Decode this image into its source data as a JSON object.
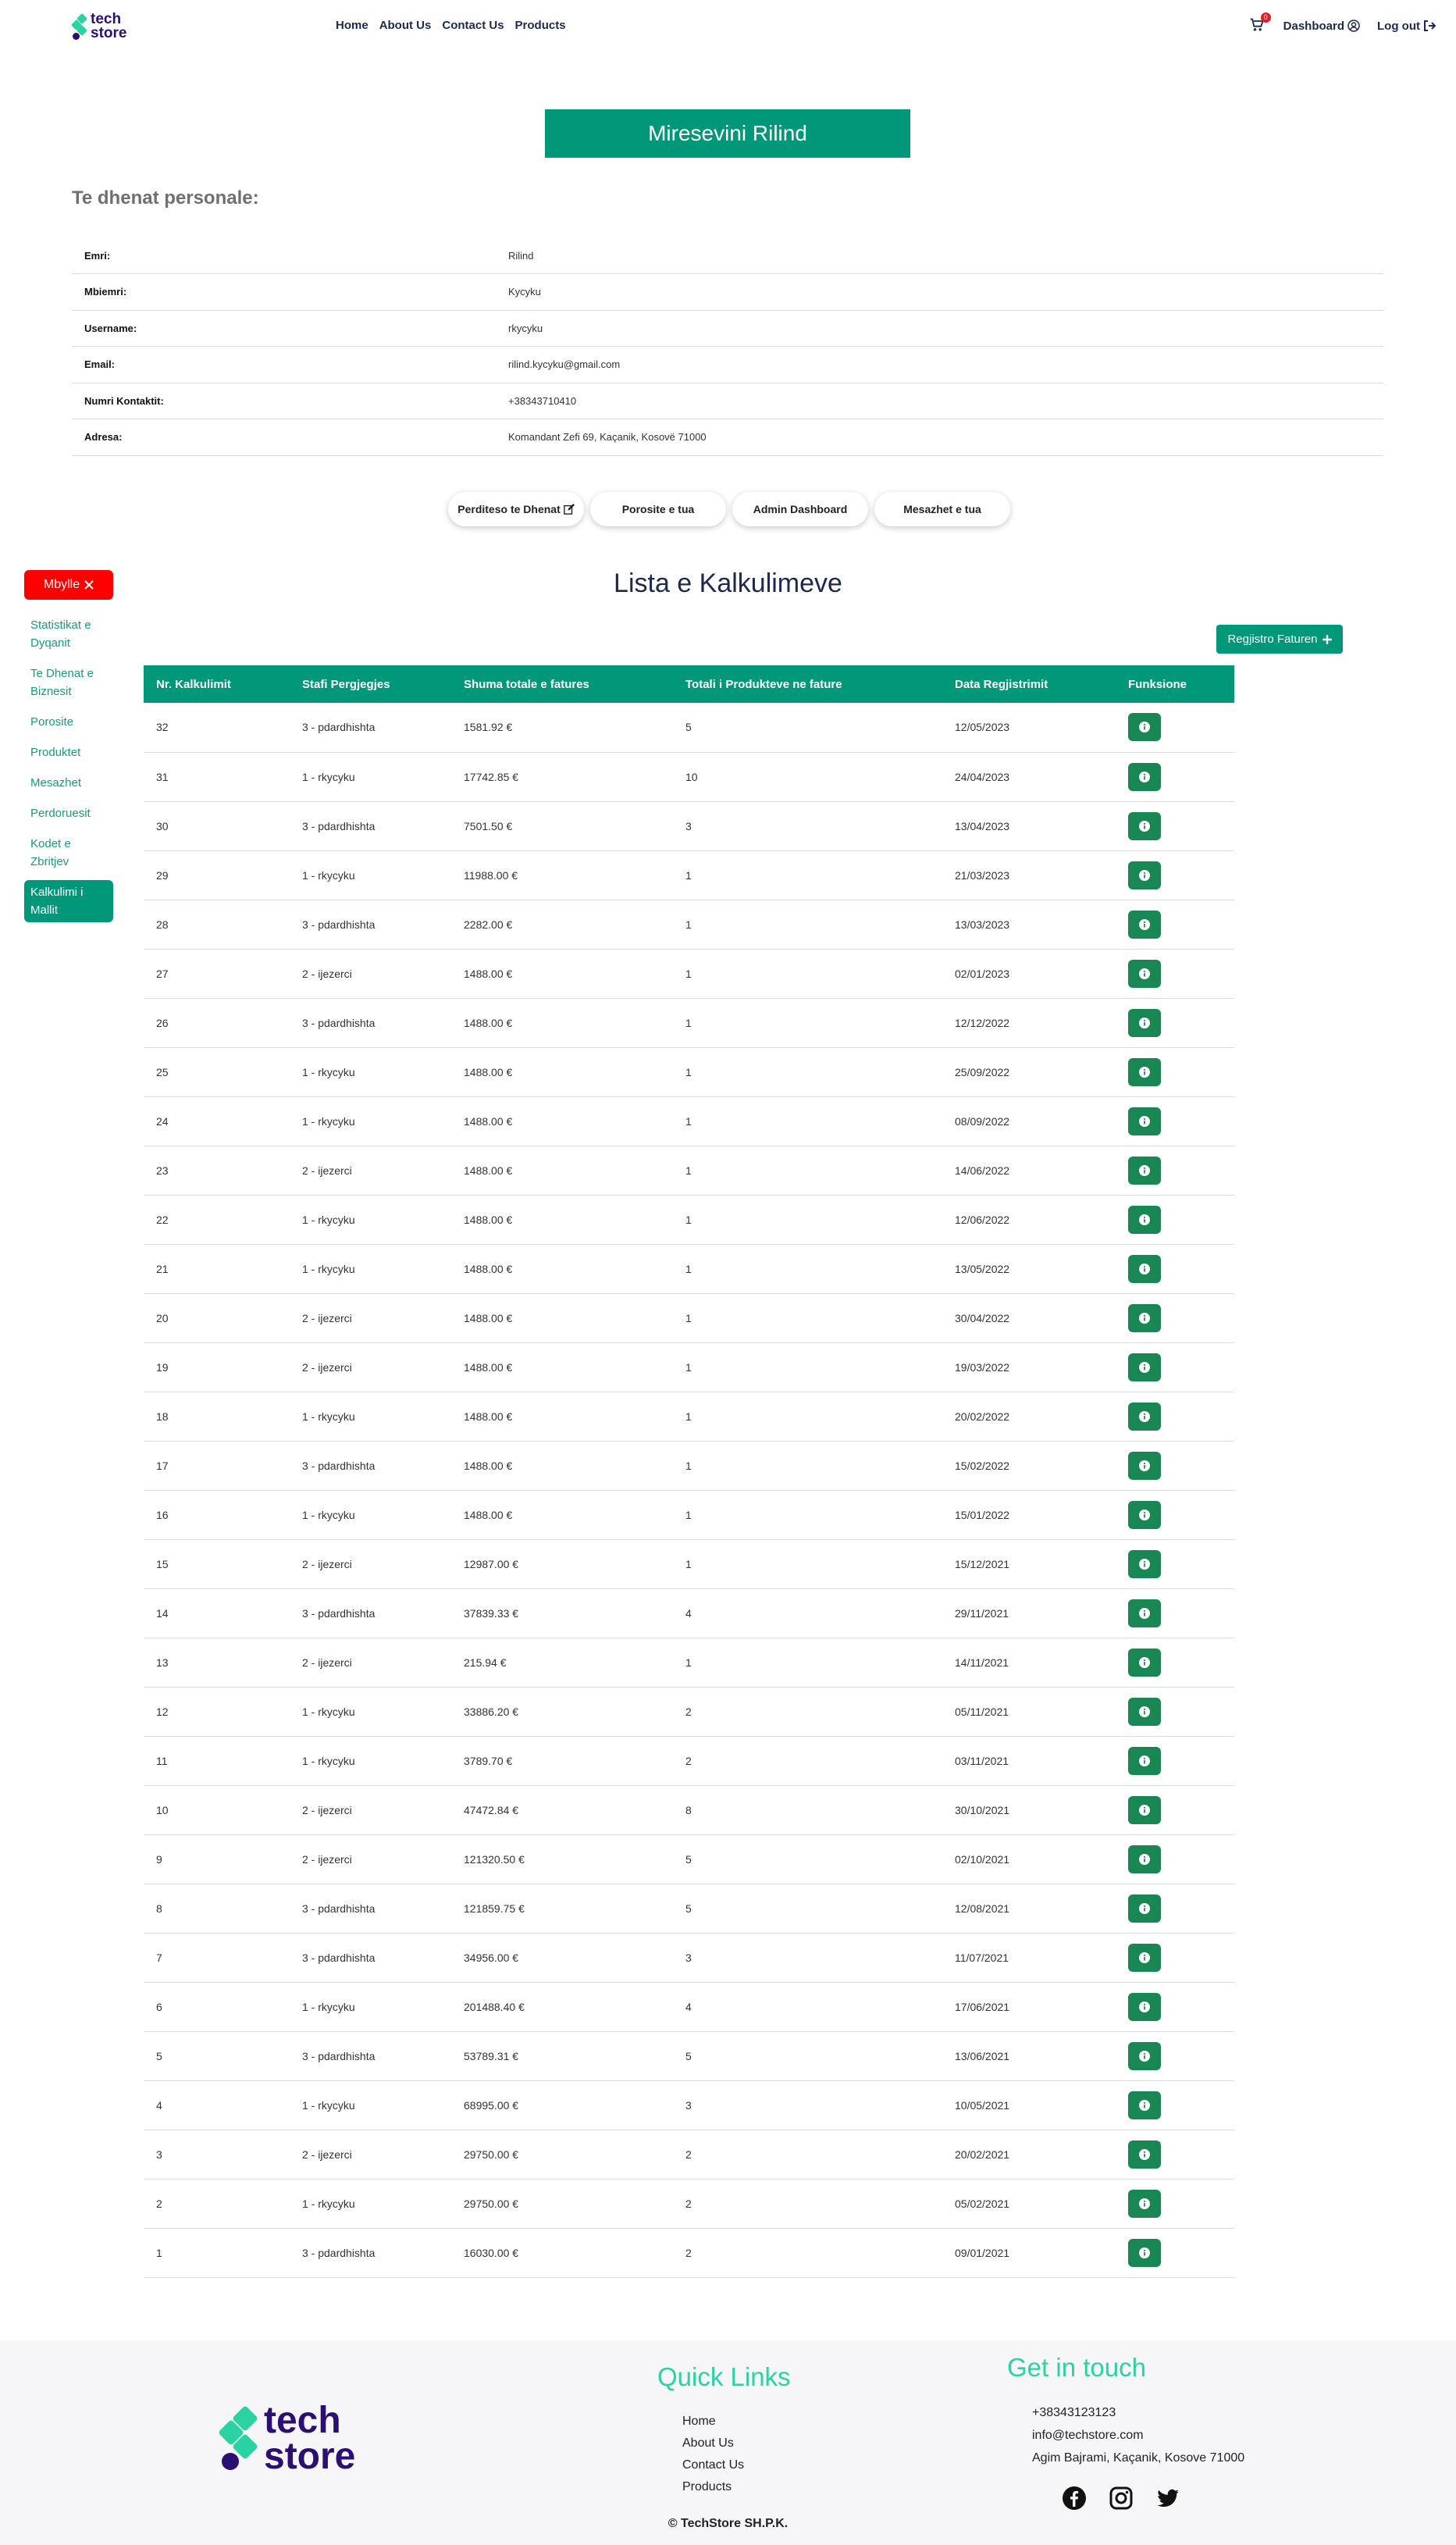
{
  "nav": {
    "logo_line1": "tech",
    "logo_line2": "store",
    "links": [
      "Home",
      "About Us",
      "Contact Us",
      "Products"
    ],
    "cart_count": "0",
    "dashboard": "Dashboard",
    "logout": "Log out"
  },
  "welcome": "Miresevini Rilind",
  "personal": {
    "title": "Te dhenat personale:",
    "rows": [
      {
        "label": "Emri:",
        "value": "Rilind"
      },
      {
        "label": "Mbiemri:",
        "value": "Kycyku"
      },
      {
        "label": "Username:",
        "value": "rkycyku"
      },
      {
        "label": "Email:",
        "value": "rilind.kycyku@gmail.com"
      },
      {
        "label": "Numri Kontaktit:",
        "value": "+38343710410"
      },
      {
        "label": "Adresa:",
        "value": "Komandant Zefi 69, Kaçanik, Kosovë 71000"
      }
    ]
  },
  "actions": [
    "Perditeso te Dhenat",
    "Porosite e tua",
    "Admin Dashboard",
    "Mesazhet e tua"
  ],
  "sidebar": {
    "close": "Mbylle",
    "items": [
      "Statistikat e Dyqanit",
      "Te Dhenat e Biznesit",
      "Porosite",
      "Produktet",
      "Mesazhet",
      "Perdoruesit",
      "Kodet e Zbritjev",
      "Kalkulimi i Mallit"
    ]
  },
  "list": {
    "title": "Lista e Kalkulimeve",
    "register": "Regjistro Faturen",
    "headers": [
      "Nr. Kalkulimit",
      "Stafi Pergjegjes",
      "Shuma totale e fatures",
      "Totali i Produkteve ne fature",
      "Data Regjistrimit",
      "Funksione"
    ],
    "rows": [
      [
        "32",
        "3 - pdardhishta",
        "1581.92 €",
        "5",
        "12/05/2023"
      ],
      [
        "31",
        "1 - rkycyku",
        "17742.85 €",
        "10",
        "24/04/2023"
      ],
      [
        "30",
        "3 - pdardhishta",
        "7501.50 €",
        "3",
        "13/04/2023"
      ],
      [
        "29",
        "1 - rkycyku",
        "11988.00 €",
        "1",
        "21/03/2023"
      ],
      [
        "28",
        "3 - pdardhishta",
        "2282.00 €",
        "1",
        "13/03/2023"
      ],
      [
        "27",
        "2 - ijezerci",
        "1488.00 €",
        "1",
        "02/01/2023"
      ],
      [
        "26",
        "3 - pdardhishta",
        "1488.00 €",
        "1",
        "12/12/2022"
      ],
      [
        "25",
        "1 - rkycyku",
        "1488.00 €",
        "1",
        "25/09/2022"
      ],
      [
        "24",
        "1 - rkycyku",
        "1488.00 €",
        "1",
        "08/09/2022"
      ],
      [
        "23",
        "2 - ijezerci",
        "1488.00 €",
        "1",
        "14/06/2022"
      ],
      [
        "22",
        "1 - rkycyku",
        "1488.00 €",
        "1",
        "12/06/2022"
      ],
      [
        "21",
        "1 - rkycyku",
        "1488.00 €",
        "1",
        "13/05/2022"
      ],
      [
        "20",
        "2 - ijezerci",
        "1488.00 €",
        "1",
        "30/04/2022"
      ],
      [
        "19",
        "2 - ijezerci",
        "1488.00 €",
        "1",
        "19/03/2022"
      ],
      [
        "18",
        "1 - rkycyku",
        "1488.00 €",
        "1",
        "20/02/2022"
      ],
      [
        "17",
        "3 - pdardhishta",
        "1488.00 €",
        "1",
        "15/02/2022"
      ],
      [
        "16",
        "1 - rkycyku",
        "1488.00 €",
        "1",
        "15/01/2022"
      ],
      [
        "15",
        "2 - ijezerci",
        "12987.00 €",
        "1",
        "15/12/2021"
      ],
      [
        "14",
        "3 - pdardhishta",
        "37839.33 €",
        "4",
        "29/11/2021"
      ],
      [
        "13",
        "2 - ijezerci",
        "215.94 €",
        "1",
        "14/11/2021"
      ],
      [
        "12",
        "1 - rkycyku",
        "33886.20 €",
        "2",
        "05/11/2021"
      ],
      [
        "11",
        "1 - rkycyku",
        "3789.70 €",
        "2",
        "03/11/2021"
      ],
      [
        "10",
        "2 - ijezerci",
        "47472.84 €",
        "8",
        "30/10/2021"
      ],
      [
        "9",
        "2 - ijezerci",
        "121320.50 €",
        "5",
        "02/10/2021"
      ],
      [
        "8",
        "3 - pdardhishta",
        "121859.75 €",
        "5",
        "12/08/2021"
      ],
      [
        "7",
        "3 - pdardhishta",
        "34956.00 €",
        "3",
        "11/07/2021"
      ],
      [
        "6",
        "1 - rkycyku",
        "201488.40 €",
        "4",
        "17/06/2021"
      ],
      [
        "5",
        "3 - pdardhishta",
        "53789.31 €",
        "5",
        "13/06/2021"
      ],
      [
        "4",
        "1 - rkycyku",
        "68995.00 €",
        "3",
        "10/05/2021"
      ],
      [
        "3",
        "2 - ijezerci",
        "29750.00 €",
        "2",
        "20/02/2021"
      ],
      [
        "2",
        "1 - rkycyku",
        "29750.00 €",
        "2",
        "05/02/2021"
      ],
      [
        "1",
        "3 - pdardhishta",
        "16030.00 €",
        "2",
        "09/01/2021"
      ]
    ]
  },
  "footer": {
    "logo_line1": "tech",
    "logo_line2": "store",
    "quick_links_title": "Quick Links",
    "quick_links": [
      "Home",
      "About Us",
      "Contact Us",
      "Products"
    ],
    "contact_title": "Get in touch",
    "contact": [
      "+38343123123",
      "info@techstore.com",
      "Agim Bajrami, Kaçanik, Kosove 71000"
    ],
    "socials": [
      "facebook-icon",
      "instagram-icon",
      "twitter-icon"
    ],
    "copyright": "© TechStore SH.P.K."
  },
  "colors": {
    "accent": "#009879",
    "brand_dark": "#2b0f73",
    "brand_light": "#2cd3a2",
    "close_red": "#ff0000",
    "info_green": "#198754"
  }
}
